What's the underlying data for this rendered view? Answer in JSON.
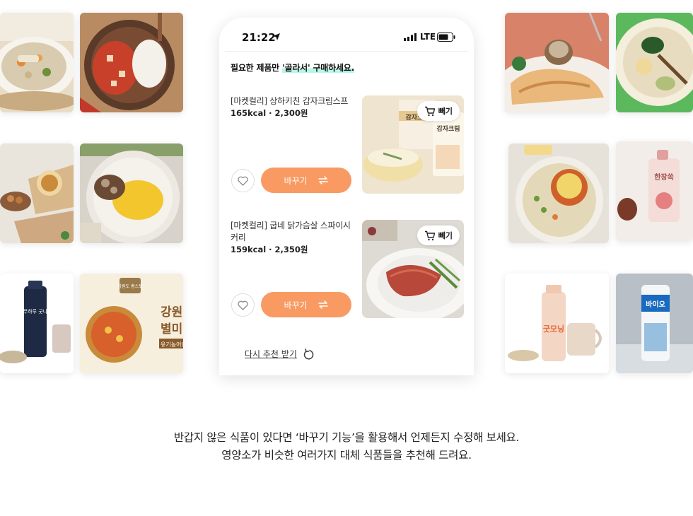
{
  "status_bar": {
    "time": "21:22",
    "network": "LTE",
    "location_icon": "location-arrow-icon",
    "signal_icon": "signal-bars-icon",
    "battery_icon": "battery-icon"
  },
  "headline": {
    "before": "필요한 제품만 ",
    "highlight": "'골라서' 구매하세요."
  },
  "products": [
    {
      "name": "[마켓컬리] 상하키친 감자크림스프",
      "info": "165kcal · 2,300원",
      "swap_label": "바꾸기",
      "remove_label": "빼기",
      "package_text_1": "감자크림",
      "package_text_2": "감자크림"
    },
    {
      "name": "[마켓컬리] 굽네 닭가슴살 스파이시 커리",
      "info": "159kcal · 2,350원",
      "swap_label": "바꾸기",
      "remove_label": "빼기"
    }
  ],
  "refresh": {
    "label": "다시 추천 받기"
  },
  "caption": {
    "line1": "반갑지 않은 식품이 있다면 ‘바꾸기 기능’을 활용해서 언제든지 수정해 보세요.",
    "line2": "영양소가 비슷한 여러가지 대체 식품들을 추천해 드려요."
  },
  "tile_labels": {
    "drink_left": "너무하루 굿나잇",
    "soup_box_brand": "강원도 홈스토",
    "soup_box_title_1": "강원",
    "soup_box_title_2": "별미",
    "soup_box_sub": "유기농어린",
    "pouch": "한장쏙",
    "drink_right": "굿모닝",
    "bio_bottle": "바이오"
  },
  "colors": {
    "accent": "#f99a63",
    "highlight": "#b8f5e8",
    "tile_green": "#5cb85c",
    "tile_salmon": "#d9826a"
  }
}
